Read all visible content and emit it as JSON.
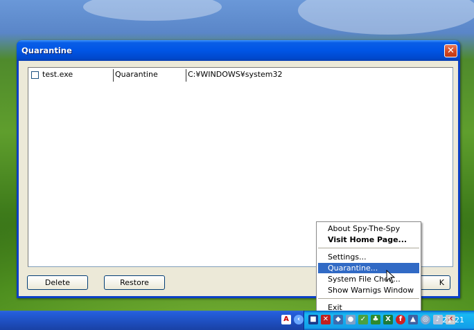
{
  "window": {
    "title": "Quarantine",
    "close_glyph": "✕"
  },
  "list": {
    "rows": [
      {
        "checked": false,
        "file": "test.exe",
        "status": "Quarantine",
        "path": "C:¥WINDOWS¥system32"
      }
    ]
  },
  "buttons": {
    "delete": "Delete",
    "restore": "Restore",
    "partial_ok_fragment": "K"
  },
  "context_menu": {
    "items": [
      {
        "label": "About Spy-The-Spy",
        "bold": false,
        "selected": false
      },
      {
        "label": "Visit Home Page...",
        "bold": true,
        "selected": false
      },
      {
        "label": "Settings...",
        "bold": false,
        "selected": false
      },
      {
        "label": "Quarantine...",
        "bold": false,
        "selected": true
      },
      {
        "label": "System File Che",
        "bold": false,
        "selected": false,
        "trailing_fragment": "k..."
      },
      {
        "label": "Show Warnigs Window",
        "bold": false,
        "selected": false
      },
      {
        "label": "Exit",
        "bold": false,
        "selected": false
      }
    ]
  },
  "taskbar": {
    "clock": "21:21",
    "tray_icons": [
      "adobe-icon",
      "chevron-left-icon",
      "spy-icon",
      "network-icon",
      "shield-icon",
      "user-icon",
      "tool-icon",
      "leaf-icon",
      "excel-icon",
      "flash-icon",
      "security-icon",
      "globe-icon",
      "volume-icon",
      "close-icon"
    ]
  },
  "colors": {
    "title_blue": "#0055e5",
    "menu_highlight": "#316ac5",
    "dialog_face": "#ece9d8"
  }
}
